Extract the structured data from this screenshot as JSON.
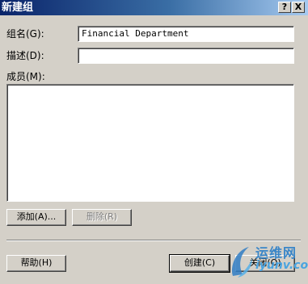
{
  "window": {
    "title": "新建组",
    "help_btn": "?",
    "close_btn": "X"
  },
  "form": {
    "name_label": "组名(G):",
    "name_value": "Financial Department",
    "desc_label": "描述(D):",
    "desc_value": "",
    "members_label": "成员(M):",
    "members": []
  },
  "buttons": {
    "add": "添加(A)...",
    "remove": "删除(R)",
    "help": "帮助(H)",
    "create": "创建(C)",
    "close": "关闭(O)"
  },
  "watermark": {
    "text": "运维网",
    "url": "iyunv.com"
  }
}
